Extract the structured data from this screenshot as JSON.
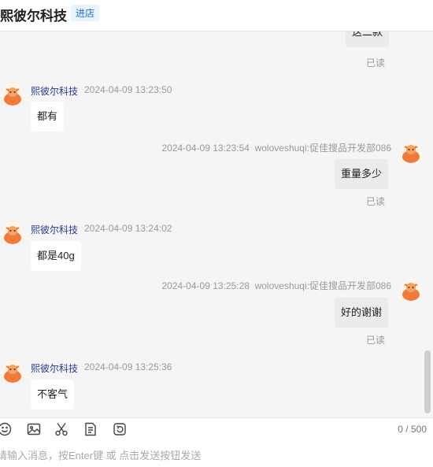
{
  "header": {
    "shop_name": "熙彼尔科技",
    "enter_store_label": "进店"
  },
  "messages": [
    {
      "text": "这二款",
      "read": "已读"
    },
    {
      "sender": "熙彼尔科技",
      "time": "2024-04-09 13:23:50",
      "text": "都有"
    },
    {
      "time": "2024-04-09 13:23:54",
      "sender": "woloveshuqi:促佳搜品开发部086",
      "text": "重量多少",
      "read": "已读"
    },
    {
      "sender": "熙彼尔科技",
      "time": "2024-04-09 13:24:02",
      "text": "都是40g"
    },
    {
      "time": "2024-04-09 13:25:28",
      "sender": "woloveshuqi:促佳搜品开发部086",
      "text": "好的谢谢",
      "read": "已读"
    },
    {
      "sender": "熙彼尔科技",
      "time": "2024-04-09 13:25:36",
      "text": "不客气"
    }
  ],
  "toolbar": {
    "icons": [
      "emoji-icon",
      "image-icon",
      "scissors-icon",
      "order-icon",
      "refresh-icon"
    ],
    "counter": "0 / 500"
  },
  "input": {
    "placeholder": "请输入消息，按Enter键 或 点击发送按钮发送"
  },
  "colors": {
    "background": "#f5f5f6",
    "sender_name": "#2b3c8f",
    "accent": "#1e6fd9",
    "avatar": "#f07a3a"
  }
}
